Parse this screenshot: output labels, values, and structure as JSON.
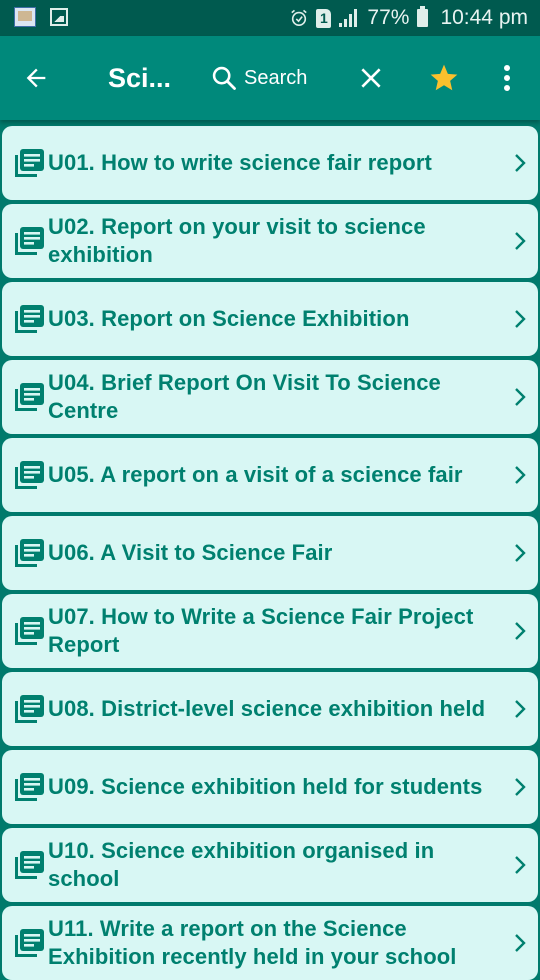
{
  "status_bar": {
    "left_icons": [
      "app-thumbnail-icon",
      "image-icon"
    ],
    "alarm_icon": "alarm-clock-icon",
    "sim_label": "1",
    "signal_icon": "signal-strength-icon",
    "battery_percent": "77%",
    "battery_icon": "battery-icon",
    "time": "10:44 pm"
  },
  "toolbar": {
    "back_icon": "arrow-left-icon",
    "title": "Sci...",
    "search_icon": "search-icon",
    "search_label": "Search",
    "close_icon": "close-icon",
    "favorite_icon": "star-icon",
    "more_icon": "more-vertical-icon"
  },
  "colors": {
    "status_bar": "#005a4f",
    "toolbar": "#00897b",
    "background": "#007a6c",
    "card": "#d8f7f4",
    "card_text": "#00806f",
    "star": "#fbc02d"
  },
  "items": [
    {
      "label": "U01. How to write science fair report",
      "icon": "document-stack-icon"
    },
    {
      "label": "U02. Report on your visit to science exhibition",
      "icon": "document-stack-icon"
    },
    {
      "label": "U03. Report on Science Exhibition",
      "icon": "document-stack-icon"
    },
    {
      "label": "U04. Brief Report On Visit To Science Centre",
      "icon": "document-stack-icon"
    },
    {
      "label": "U05. A report on a visit of a science fair",
      "icon": "document-stack-icon"
    },
    {
      "label": "U06. A Visit to Science Fair",
      "icon": "document-stack-icon"
    },
    {
      "label": "U07. How to Write a Science Fair Project Report",
      "icon": "document-stack-icon"
    },
    {
      "label": "U08. District-level science exhibition held",
      "icon": "document-stack-icon"
    },
    {
      "label": "U09. Science exhibition held for students",
      "icon": "document-stack-icon"
    },
    {
      "label": "U10. Science exhibition organised in school",
      "icon": "document-stack-icon"
    },
    {
      "label": "U11. Write a report on the Science Exhibition recently held in your school",
      "icon": "document-stack-icon"
    }
  ]
}
